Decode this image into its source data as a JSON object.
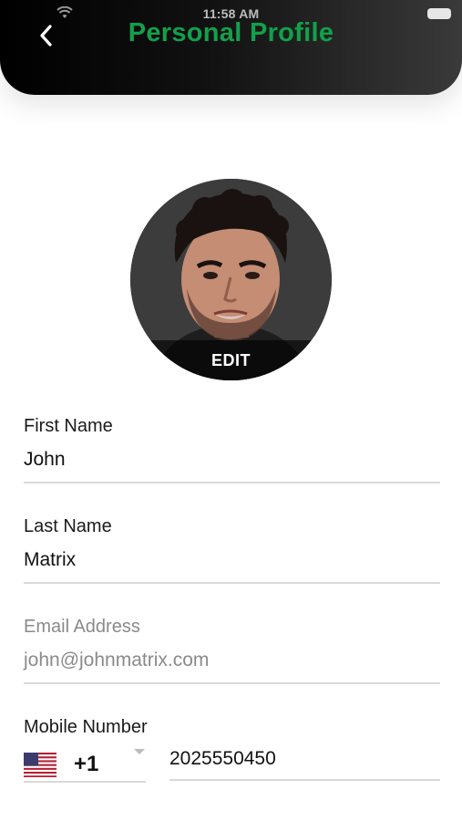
{
  "status_bar": {
    "time": "11:58 AM"
  },
  "header": {
    "title": "Personal Profile",
    "back_icon": "chevron-left-icon"
  },
  "avatar": {
    "edit_label": "EDIT"
  },
  "form": {
    "first_name": {
      "label": "First Name",
      "value": "John"
    },
    "last_name": {
      "label": "Last Name",
      "value": "Matrix"
    },
    "email": {
      "label": "Email Address",
      "value": "john@johnmatrix.com"
    },
    "mobile": {
      "label": "Mobile Number",
      "country_code": "+1",
      "number": "2025550450",
      "flag_icon": "us-flag-icon"
    }
  },
  "colors": {
    "title_green": "#11a14a",
    "header_dark": "#000000",
    "divider": "#d9d9d9",
    "disabled_text": "#8a8a8a"
  }
}
